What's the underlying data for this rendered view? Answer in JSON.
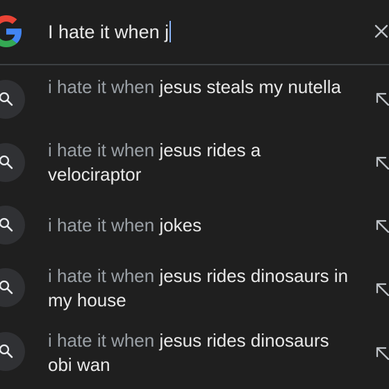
{
  "search": {
    "query": "I hate it when j",
    "logo": "google-g-logo",
    "clear_icon": "close-icon",
    "caret_color": "#8ab4f8"
  },
  "colors": {
    "background": "#1f1f1f",
    "text_primary": "#e8e8e8",
    "text_secondary": "#9aa0a6",
    "icon_circle": "#303134",
    "divider": "#3c4043"
  },
  "suggestions": [
    {
      "prefix": "i hate it when ",
      "completion": "jesus steals my nutella",
      "icon": "search-icon",
      "action_icon": "arrow-up-left-icon"
    },
    {
      "prefix": "i hate it when ",
      "completion": "jesus rides a velociraptor",
      "icon": "search-icon",
      "action_icon": "arrow-up-left-icon"
    },
    {
      "prefix": "i hate it when ",
      "completion": "jokes",
      "icon": "search-icon",
      "action_icon": "arrow-up-left-icon"
    },
    {
      "prefix": "i hate it when ",
      "completion": "jesus rides dinosaurs in my house",
      "icon": "search-icon",
      "action_icon": "arrow-up-left-icon"
    },
    {
      "prefix": "i hate it when ",
      "completion": "jesus rides dinosaurs obi wan",
      "icon": "search-icon",
      "action_icon": "arrow-up-left-icon"
    }
  ]
}
